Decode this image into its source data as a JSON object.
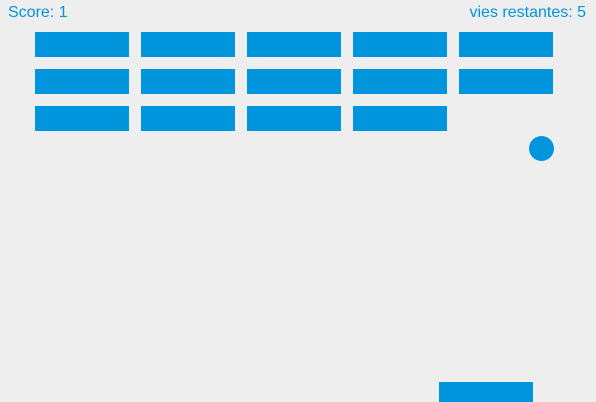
{
  "hud": {
    "score_text": "Score: 1",
    "lives_text": "vies restantes: 5"
  },
  "game": {
    "score": 1,
    "lives": 5,
    "brick_rows": 3,
    "brick_columns": 5,
    "bricks_alive": [
      [
        true,
        true,
        true,
        true,
        true
      ],
      [
        true,
        true,
        true,
        true,
        true
      ],
      [
        true,
        true,
        true,
        true,
        false
      ]
    ]
  },
  "colors": {
    "background": "#eeeeee",
    "accent": "#0095dd"
  }
}
